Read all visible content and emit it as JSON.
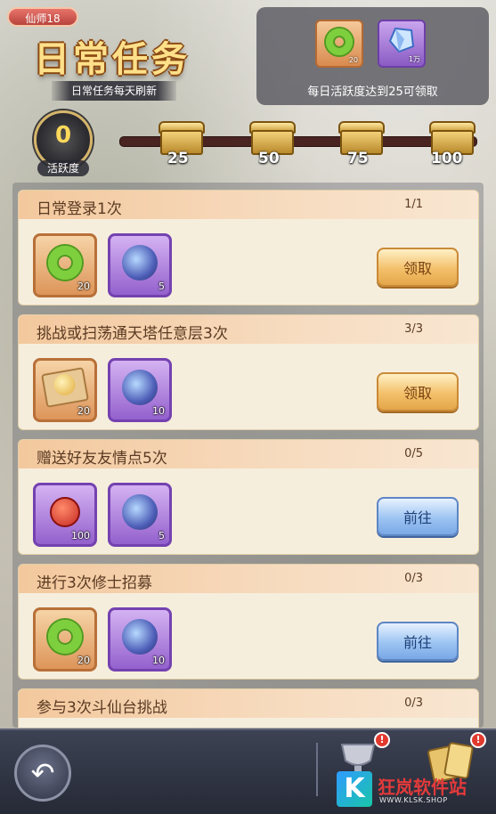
{
  "header": {
    "level_badge": "仙师18",
    "title": "日常任务",
    "subtitle": "日常任务每天刷新"
  },
  "reward_panel": {
    "items": [
      {
        "icon": "jade-ring-icon",
        "count": "20"
      },
      {
        "icon": "crystal-icon",
        "count": "1万"
      }
    ],
    "caption": "每日活跃度达到25可领取"
  },
  "activity": {
    "value": "0",
    "label": "活跃度",
    "progress_fraction": 0,
    "milestones": [
      "25",
      "50",
      "75",
      "100"
    ]
  },
  "tasks": [
    {
      "title": "日常登录1次",
      "progress": "1/1",
      "rewards": [
        {
          "icon": "jade-ring-icon",
          "style": "orange",
          "count": "20"
        },
        {
          "icon": "spirit-icon",
          "style": "purple",
          "count": "5"
        }
      ],
      "button": {
        "label": "领取",
        "style": "gold"
      }
    },
    {
      "title": "挑战或扫荡通天塔任意层3次",
      "progress": "3/3",
      "rewards": [
        {
          "icon": "pearl-icon",
          "style": "orange",
          "count": "20"
        },
        {
          "icon": "spirit-icon",
          "style": "purple",
          "count": "10"
        }
      ],
      "button": {
        "label": "领取",
        "style": "gold"
      }
    },
    {
      "title": "赠送好友友情点5次",
      "progress": "0/5",
      "rewards": [
        {
          "icon": "knot-icon",
          "style": "purple",
          "count": "100"
        },
        {
          "icon": "spirit-icon",
          "style": "purple",
          "count": "5"
        }
      ],
      "button": {
        "label": "前往",
        "style": "blue"
      }
    },
    {
      "title": "进行3次修士招募",
      "progress": "0/3",
      "rewards": [
        {
          "icon": "jade-ring-icon",
          "style": "orange",
          "count": "20"
        },
        {
          "icon": "spirit-icon",
          "style": "purple",
          "count": "10"
        }
      ],
      "button": {
        "label": "前往",
        "style": "blue"
      }
    },
    {
      "title": "参与3次斗仙台挑战",
      "progress": "0/3",
      "rewards": [],
      "button": null
    }
  ],
  "bottom_bar": {
    "alert_mark": "!"
  },
  "watermark": {
    "logo_letter": "K",
    "name": "狂岚软件站",
    "url": "WWW.KLSK.SHOP"
  },
  "colors": {
    "gold_button": "#f3c06a",
    "blue_button": "#9cc4f2",
    "header_band": "#f3c89d",
    "alert": "#e23a2e"
  }
}
